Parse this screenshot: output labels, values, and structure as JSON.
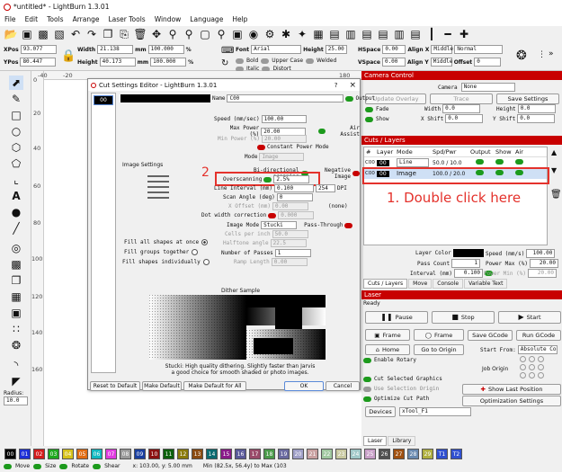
{
  "title": "*untitled* - LightBurn 1.3.01",
  "menu": [
    "File",
    "Edit",
    "Tools",
    "Arrange",
    "Laser Tools",
    "Window",
    "Language",
    "Help"
  ],
  "numbar": {
    "xpos_label": "XPos",
    "xpos": "93.077",
    "ypos_label": "YPos",
    "ypos": "80.447",
    "width_label": "Width",
    "width": "21.138",
    "height_label": "Height",
    "height": "40.173",
    "unit": "mm",
    "pct1": "100.000",
    "pct2": "100.000",
    "pct_unit": "%",
    "font_label": "Font",
    "font": "Arial",
    "height2_label": "Height",
    "height2": "25.00",
    "hspace_label": "HSpace",
    "hspace": "0.00",
    "vspace_label": "VSpace",
    "vspace": "0.00",
    "alignx_label": "Align X",
    "alignx": "Middle",
    "aligny_label": "Align Y",
    "aligny": "Middle",
    "normal": "Normal",
    "offset_label": "Offset",
    "offset": "0",
    "bold": "Bold",
    "italic": "Italic",
    "upper": "Upper Case",
    "welded": "Welded",
    "distort": "Distort"
  },
  "ruler": {
    "x": [
      "-40",
      "-20",
      "0",
      "20",
      "40",
      "60",
      "80",
      "100",
      "120",
      "140",
      "160",
      "180"
    ],
    "y": [
      "0",
      "20",
      "40",
      "60",
      "80",
      "100",
      "120",
      "140",
      "160"
    ]
  },
  "radius": {
    "label": "Radius:",
    "value": "10.0"
  },
  "camera": {
    "header": "Camera Control",
    "camera_label": "Camera",
    "camera_value": "None",
    "update_overlay": "Update Overlay",
    "trace": "Trace",
    "save_settings": "Save Settings",
    "fade": "Fade",
    "show": "Show",
    "width_label": "Width",
    "width": "0.0",
    "height_label": "Height",
    "height": "0.0",
    "xshift_label": "X Shift",
    "xshift": "0.0",
    "yshift_label": "Y Shift",
    "yshift": "0.0"
  },
  "cuts": {
    "header": "Cuts / Layers",
    "columns": [
      "#",
      "Layer",
      "Mode",
      "Spd/Pwr",
      "Output",
      "Show",
      "Air"
    ],
    "rows": [
      {
        "num": "C00",
        "layer": "00",
        "mode": "Line",
        "spd": "50.0 / 10.0"
      },
      {
        "num": "C00",
        "layer": "00",
        "mode": "Image",
        "spd": "100.0 / 20.0"
      }
    ],
    "layer_color_label": "Layer Color",
    "speed_label": "Speed (mm/s)",
    "speed": "100.00",
    "pass_label": "Pass Count",
    "pass": "1",
    "power_label": "Power Max (%)",
    "power": "20.00",
    "interval_label": "Interval (mm)",
    "interval": "0.100",
    "powermin_label": "Power Min (%)",
    "powermin": "20.00",
    "tabs": [
      "Cuts / Layers",
      "Move",
      "Console",
      "Variable Text"
    ]
  },
  "laser": {
    "header": "Laser",
    "status": "Ready",
    "pause": "Pause",
    "stop": "Stop",
    "start": "Start",
    "frame1": "Frame",
    "frame2": "Frame",
    "save_gcode": "Save GCode",
    "run_gcode": "Run GCode",
    "home": "Home",
    "go_origin": "Go to Origin",
    "start_from_label": "Start From:",
    "start_from": "Absolute Coords",
    "enable_rotary": "Enable Rotary",
    "job_origin": "Job Origin",
    "cut_selected": "Cut Selected Graphics",
    "use_selection": "Use Selection Origin",
    "optimize": "Optimize Cut Path",
    "show_last": "Show Last Position",
    "optimization_settings": "Optimization Settings",
    "devices": "Devices",
    "device": "xTool_F1",
    "tabs": [
      "Laser",
      "Library"
    ]
  },
  "dialog": {
    "title": "Cut Settings Editor - LightBurn 1.3.01",
    "help": "?",
    "close": "×",
    "layer": "00",
    "name_label": "Name",
    "name": "C00",
    "output": "Output",
    "speed_label": "Speed (mm/sec)",
    "speed": "100.00",
    "maxpower_label": "Max Power (%)",
    "maxpower": "20.00",
    "air_assist": "Air Assist",
    "minpower_label": "Min Power (%)",
    "minpower": "20.00",
    "const_power": "Constant Power Mode",
    "mode_label": "Mode",
    "mode": "Image",
    "image_settings": "Image Settings",
    "bidir": "Bi-directional scanning",
    "negative": "Negative Image",
    "overscan_label": "Overscanning",
    "overscan": "2.5%",
    "line_interval_label": "Line Interval (mm)",
    "line_interval": "0.100",
    "dpi": "254",
    "dpi_label": "DPI",
    "scan_angle_label": "Scan Angle (deg)",
    "scan_angle": "0",
    "xoffset_label": "X Offset (mm)",
    "xoffset": "0.00",
    "none": "(none)",
    "dotwidth_label": "Dot width correction",
    "dotwidth": "0.000",
    "image_mode_label": "Image Mode",
    "image_mode": "Stucki",
    "pass_through": "Pass-Through",
    "cells_label": "Cells per inch",
    "cells": "50.0",
    "halftone_label": "Halftone angle",
    "halftone": "22.5",
    "passes_label": "Number of Passes",
    "passes": "1",
    "ramp_label": "Ramp Length",
    "ramp": "0.00",
    "fill_all": "Fill all shapes at once",
    "fill_groups": "Fill groups together",
    "fill_individually": "Fill shapes individually",
    "dither_sample": "Dither Sample",
    "desc1": "Stucki: High quality dithering. Slightly faster than Jarvis",
    "desc2": "a good choice for smooth shaded or photo images.",
    "reset": "Reset to Default",
    "make_default": "Make Default",
    "make_default_all": "Make Default for All",
    "ok": "OK",
    "cancel": "Cancel"
  },
  "annotations": {
    "one": "1. Double click here",
    "two": "2"
  },
  "palette": [
    "00",
    "01",
    "02",
    "03",
    "04",
    "05",
    "06",
    "07",
    "08",
    "09",
    "10",
    "11",
    "12",
    "13",
    "14",
    "15",
    "16",
    "17",
    "18",
    "19",
    "20",
    "21",
    "22",
    "23",
    "24",
    "25",
    "26",
    "27",
    "28",
    "29",
    "T1",
    "T2"
  ],
  "palette_colors": [
    "#000000",
    "#1d2fd6",
    "#d41c1c",
    "#1ea81e",
    "#d6c21a",
    "#e06b12",
    "#10b8c0",
    "#e03be0",
    "#9a9a9a",
    "#1a3fa0",
    "#8a1010",
    "#0b5f0b",
    "#8a7a0a",
    "#8a4a10",
    "#0a6a70",
    "#8a1a8a",
    "#5a5a9a",
    "#9a4a6a",
    "#4a9a4a",
    "#6a6aa0",
    "#a0a0c8",
    "#c8a0a0",
    "#a0c8a0",
    "#c8c8a0",
    "#a0c8c8",
    "#c8a0c8",
    "#505050",
    "#a05010",
    "#6a8ab0",
    "#b0b040",
    "#3050d0",
    "#3050d0"
  ],
  "status": {
    "move": "Move",
    "size": "Size",
    "rotate": "Rotate",
    "shear": "Shear",
    "coords": "x: 103.00, y: 5.00 mm",
    "minmax": "Min (82.5x, 56.4y) to Max (103"
  }
}
